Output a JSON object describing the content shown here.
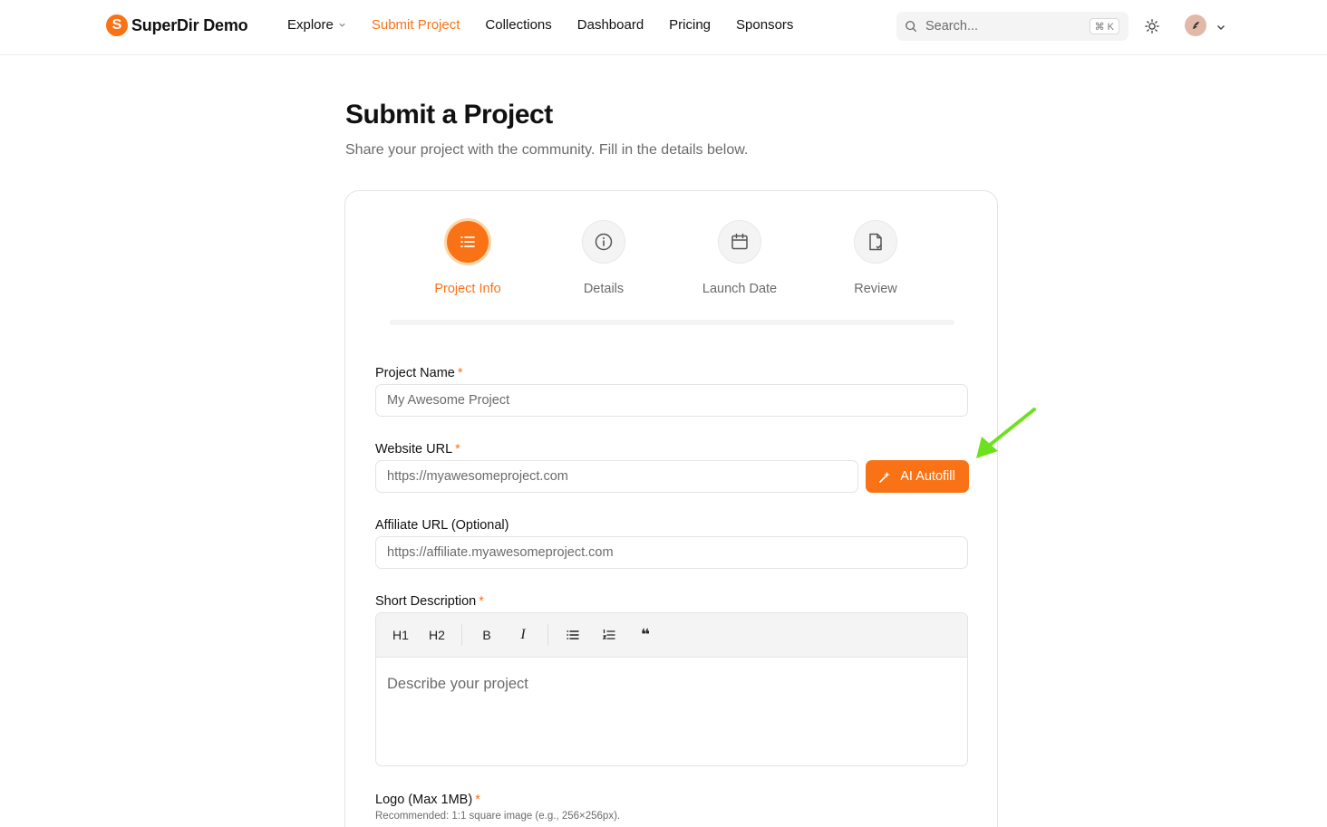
{
  "header": {
    "brand_letter": "S",
    "brand_name": "SuperDir Demo",
    "nav": [
      {
        "label": "Explore",
        "has_dropdown": true,
        "active": false
      },
      {
        "label": "Submit Project",
        "active": true
      },
      {
        "label": "Collections",
        "active": false
      },
      {
        "label": "Dashboard",
        "active": false
      },
      {
        "label": "Pricing",
        "active": false
      },
      {
        "label": "Sponsors",
        "active": false
      }
    ],
    "search_placeholder": "Search...",
    "search_shortcut": "⌘ K",
    "icons": [
      "search-icon",
      "sun-icon",
      "avatar",
      "chevron-down-icon"
    ]
  },
  "page": {
    "title": "Submit a Project",
    "subtitle": "Share your project with the community. Fill in the details below."
  },
  "steps": [
    {
      "label": "Project Info",
      "icon": "list-icon",
      "active": true
    },
    {
      "label": "Details",
      "icon": "info-icon",
      "active": false
    },
    {
      "label": "Launch Date",
      "icon": "calendar-icon",
      "active": false
    },
    {
      "label": "Review",
      "icon": "file-check-icon",
      "active": false
    }
  ],
  "form": {
    "project_name": {
      "label": "Project Name",
      "required": "*",
      "placeholder": "My Awesome Project"
    },
    "website_url": {
      "label": "Website URL",
      "required": "*",
      "placeholder": "https://myawesomeproject.com"
    },
    "ai_autofill": {
      "label": "AI Autofill",
      "icon": "sparkle-icon"
    },
    "affiliate_url": {
      "label": "Affiliate URL (Optional)",
      "placeholder": "https://affiliate.myawesomeproject.com"
    },
    "short_description": {
      "label": "Short Description",
      "required": "*",
      "placeholder": "Describe your project",
      "toolbar": {
        "h1": "H1",
        "h2": "H2",
        "bold": "B",
        "italic": "I",
        "quote": "❝"
      }
    },
    "logo": {
      "label": "Logo (Max 1MB)",
      "required": "*",
      "hint": "Recommended: 1:1 square image (e.g., 256×256px)."
    }
  },
  "colors": {
    "accent": "#f97316",
    "annotation_arrow": "#6ee11f"
  }
}
